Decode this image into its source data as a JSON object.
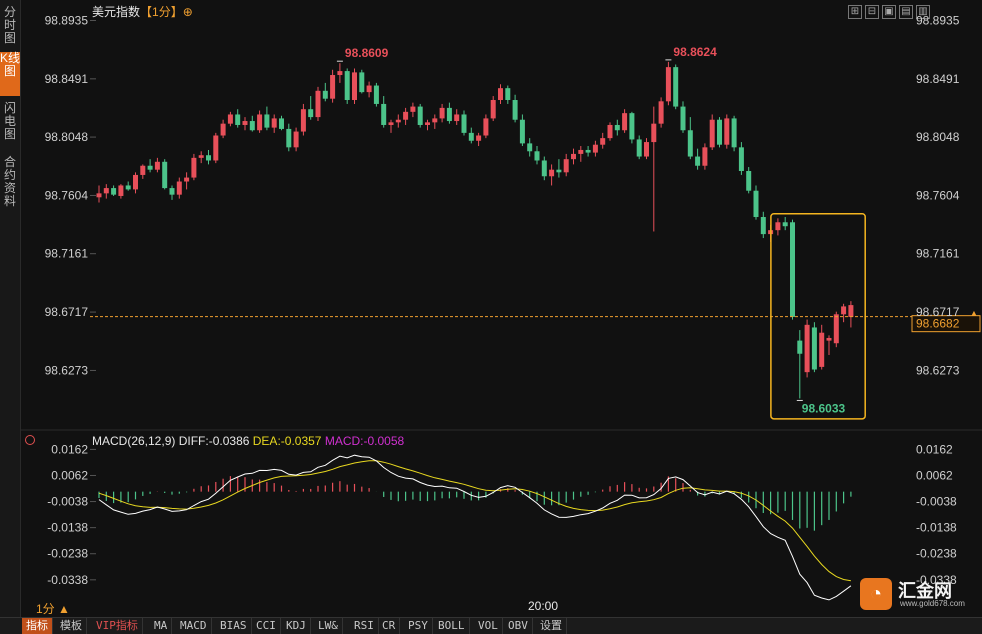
{
  "left_tabs": [
    {
      "label": "分时图",
      "active": false
    },
    {
      "label": "K线图",
      "active": true
    },
    {
      "label": "闪电图",
      "active": false
    },
    {
      "label": "合约资料",
      "active": false
    }
  ],
  "header": {
    "instrument": "美元指数",
    "period": "【1分】",
    "period_icon": "⊕"
  },
  "window_buttons": [
    "⊞",
    "⊟",
    "▣",
    "▤",
    "▥"
  ],
  "colors": {
    "up": "#e8505a",
    "down": "#4cc48a",
    "diff": "#ffffff",
    "dea": "#e8d820",
    "macd": "#d030d0",
    "highlight": "#f5b520",
    "current": "#f0a030"
  },
  "chart_data": [
    {
      "type": "candlestick",
      "title": "美元指数",
      "y_ticks": [
        "98.8935",
        "98.8491",
        "98.8048",
        "98.7604",
        "98.7161",
        "98.6717",
        "98.6273"
      ],
      "ylim": [
        98.582,
        98.9045
      ],
      "current_price": "98.6682",
      "annotations": {
        "high1": "98.8609",
        "high2": "98.8624",
        "low": "98.6033"
      },
      "x_label": "20:00",
      "candles": [
        [
          98.759,
          98.768,
          98.755,
          98.762
        ],
        [
          98.762,
          98.769,
          98.758,
          98.766
        ],
        [
          98.766,
          98.768,
          98.76,
          98.761
        ],
        [
          98.76,
          98.769,
          98.758,
          98.768
        ],
        [
          98.768,
          98.771,
          98.764,
          98.765
        ],
        [
          98.765,
          98.778,
          98.762,
          98.776
        ],
        [
          98.776,
          98.784,
          98.773,
          98.783
        ],
        [
          98.783,
          98.788,
          98.778,
          98.78
        ],
        [
          98.78,
          98.789,
          98.778,
          98.786
        ],
        [
          98.786,
          98.788,
          98.765,
          98.766
        ],
        [
          98.766,
          98.768,
          98.757,
          98.761
        ],
        [
          98.761,
          98.774,
          98.758,
          98.771
        ],
        [
          98.771,
          98.778,
          98.765,
          98.774
        ],
        [
          98.774,
          98.792,
          98.772,
          98.789
        ],
        [
          98.789,
          98.794,
          98.785,
          98.791
        ],
        [
          98.791,
          98.795,
          98.784,
          98.787
        ],
        [
          98.787,
          98.808,
          98.785,
          98.806
        ],
        [
          98.806,
          98.818,
          98.804,
          98.815
        ],
        [
          98.815,
          98.824,
          98.813,
          98.822
        ],
        [
          98.822,
          98.826,
          98.812,
          98.814
        ],
        [
          98.814,
          98.82,
          98.81,
          98.817
        ],
        [
          98.817,
          98.821,
          98.809,
          98.81
        ],
        [
          98.81,
          98.825,
          98.808,
          98.822
        ],
        [
          98.822,
          98.828,
          98.81,
          98.812
        ],
        [
          98.812,
          98.822,
          98.808,
          98.819
        ],
        [
          98.819,
          98.821,
          98.81,
          98.811
        ],
        [
          98.811,
          98.815,
          98.794,
          98.797
        ],
        [
          98.797,
          98.812,
          98.794,
          98.809
        ],
        [
          98.809,
          98.83,
          98.806,
          98.826
        ],
        [
          98.826,
          98.836,
          98.818,
          98.82
        ],
        [
          98.82,
          98.843,
          98.817,
          98.84
        ],
        [
          98.84,
          98.846,
          98.832,
          98.834
        ],
        [
          98.834,
          98.856,
          98.831,
          98.852
        ],
        [
          98.852,
          98.861,
          98.846,
          98.855
        ],
        [
          98.855,
          98.857,
          98.83,
          98.833
        ],
        [
          98.833,
          98.857,
          98.83,
          98.854
        ],
        [
          98.854,
          98.856,
          98.838,
          98.839
        ],
        [
          98.839,
          98.847,
          98.835,
          98.844
        ],
        [
          98.844,
          98.846,
          98.828,
          98.83
        ],
        [
          98.83,
          98.836,
          98.812,
          98.814
        ],
        [
          98.814,
          98.818,
          98.808,
          98.816
        ],
        [
          98.816,
          98.822,
          98.812,
          98.818
        ],
        [
          98.818,
          98.827,
          98.814,
          98.824
        ],
        [
          98.824,
          98.831,
          98.82,
          98.828
        ],
        [
          98.828,
          98.83,
          98.812,
          98.814
        ],
        [
          98.814,
          98.818,
          98.81,
          98.816
        ],
        [
          98.816,
          98.822,
          98.811,
          98.819
        ],
        [
          98.819,
          98.83,
          98.816,
          98.827
        ],
        [
          98.827,
          98.831,
          98.815,
          98.817
        ],
        [
          98.817,
          98.826,
          98.814,
          98.822
        ],
        [
          98.822,
          98.825,
          98.806,
          98.808
        ],
        [
          98.808,
          98.812,
          98.8,
          98.802
        ],
        [
          98.802,
          98.808,
          98.798,
          98.806
        ],
        [
          98.806,
          98.822,
          98.804,
          98.819
        ],
        [
          98.819,
          98.836,
          98.817,
          98.833
        ],
        [
          98.833,
          98.845,
          98.83,
          98.842
        ],
        [
          98.842,
          98.844,
          98.83,
          98.833
        ],
        [
          98.833,
          98.837,
          98.816,
          98.818
        ],
        [
          98.818,
          98.822,
          98.798,
          98.8
        ],
        [
          98.8,
          98.804,
          98.79,
          98.794
        ],
        [
          98.794,
          98.798,
          98.784,
          98.787
        ],
        [
          98.787,
          98.79,
          98.772,
          98.775
        ],
        [
          98.775,
          98.784,
          98.768,
          98.78
        ],
        [
          98.78,
          98.788,
          98.774,
          98.778
        ],
        [
          98.778,
          98.792,
          98.775,
          98.788
        ],
        [
          98.788,
          98.796,
          98.784,
          98.792
        ],
        [
          98.792,
          98.798,
          98.786,
          98.795
        ],
        [
          98.795,
          98.798,
          98.79,
          98.793
        ],
        [
          98.793,
          98.802,
          98.79,
          98.799
        ],
        [
          98.799,
          98.808,
          98.796,
          98.804
        ],
        [
          98.804,
          98.816,
          98.802,
          98.814
        ],
        [
          98.814,
          98.818,
          98.806,
          98.81
        ],
        [
          98.81,
          98.826,
          98.808,
          98.823
        ],
        [
          98.823,
          98.824,
          98.8,
          98.803
        ],
        [
          98.803,
          98.806,
          98.788,
          98.79
        ],
        [
          98.79,
          98.804,
          98.788,
          98.801
        ],
        [
          98.801,
          98.828,
          98.733,
          98.815
        ],
        [
          98.815,
          98.835,
          98.812,
          98.832
        ],
        [
          98.832,
          98.862,
          98.829,
          98.858
        ],
        [
          98.858,
          98.86,
          98.826,
          98.828
        ],
        [
          98.828,
          98.832,
          98.808,
          98.81
        ],
        [
          98.81,
          98.82,
          98.788,
          98.79
        ],
        [
          98.79,
          98.796,
          98.78,
          98.783
        ],
        [
          98.783,
          98.8,
          98.78,
          98.797
        ],
        [
          98.797,
          98.822,
          98.795,
          98.818
        ],
        [
          98.818,
          98.82,
          98.797,
          98.799
        ],
        [
          98.799,
          98.822,
          98.796,
          98.819
        ],
        [
          98.819,
          98.821,
          98.794,
          98.797
        ],
        [
          98.797,
          98.801,
          98.776,
          98.779
        ],
        [
          98.779,
          98.782,
          98.762,
          98.764
        ],
        [
          98.764,
          98.768,
          98.742,
          98.744
        ],
        [
          98.744,
          98.748,
          98.728,
          98.731
        ],
        [
          98.731,
          98.738,
          98.725,
          98.734
        ],
        [
          98.734,
          98.743,
          98.73,
          98.74
        ],
        [
          98.74,
          98.744,
          98.734,
          98.737
        ],
        [
          98.74,
          98.742,
          98.666,
          98.668
        ],
        [
          98.65,
          98.658,
          98.606,
          98.64
        ],
        [
          98.626,
          98.666,
          98.622,
          98.662
        ],
        [
          98.66,
          98.664,
          98.626,
          98.628
        ],
        [
          98.63,
          98.662,
          98.628,
          98.656
        ],
        [
          98.65,
          98.654,
          98.639,
          98.652
        ],
        [
          98.648,
          98.672,
          98.645,
          98.67
        ],
        [
          98.67,
          98.678,
          98.664,
          98.676
        ],
        [
          98.668,
          98.68,
          98.66,
          98.677
        ]
      ]
    },
    {
      "type": "macd",
      "params": "MACD(26,12,9)",
      "diff_label": "DIFF:-0.0386",
      "dea_label": "DEA:-0.0357",
      "macd_label": "MACD:-0.0058",
      "y_ticks": [
        "0.0162",
        "0.0062",
        "-0.0038",
        "-0.0138",
        "-0.0238",
        "-0.0338"
      ],
      "ylim": [
        -0.04,
        0.0175
      ]
    }
  ],
  "bottom": {
    "period": "1分 ▲",
    "tabs": [
      "指标",
      "模板",
      "VIP指标",
      "MA",
      "MACD",
      "BIAS",
      "CCI",
      "KDJ",
      "LW&",
      "RSI",
      "CR",
      "PSY",
      "BOLL",
      "VOL",
      "OBV",
      "设置"
    ]
  },
  "logo": {
    "icon": "◔",
    "name": "汇金网",
    "url": "www.gold678.com"
  }
}
